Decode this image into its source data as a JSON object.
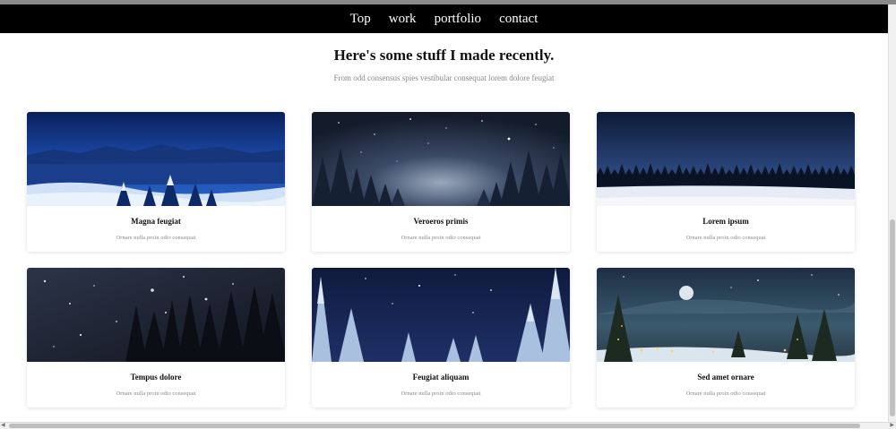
{
  "nav": {
    "items": [
      "Top",
      "work",
      "portfolio",
      "contact"
    ]
  },
  "header": {
    "title": "Here's some stuff I made recently.",
    "subtitle": "From odd consensus spies vestibular consequat lorem dolore feugiat"
  },
  "cards": [
    {
      "title": "Magna feugiat",
      "description": "Ornare nulla proin odio consequat",
      "image": "snowy-mountain-valley"
    },
    {
      "title": "Veroeros primis",
      "description": "Ornare nulla proin odio consequat",
      "image": "starry-pine-forest"
    },
    {
      "title": "Lorem ipsum",
      "description": "Ornare nulla proin odio consequat",
      "image": "treeline-snowfield"
    },
    {
      "title": "Tempus dolore",
      "description": "Ornare nulla proin odio consequat",
      "image": "snowfall-dark-forest"
    },
    {
      "title": "Feugiat aliquam",
      "description": "Ornare nulla proin odio consequat",
      "image": "frosted-pine-night"
    },
    {
      "title": "Sed amet ornare",
      "description": "Ornare nulla proin odio consequat",
      "image": "moonlit-christmas-village"
    }
  ]
}
